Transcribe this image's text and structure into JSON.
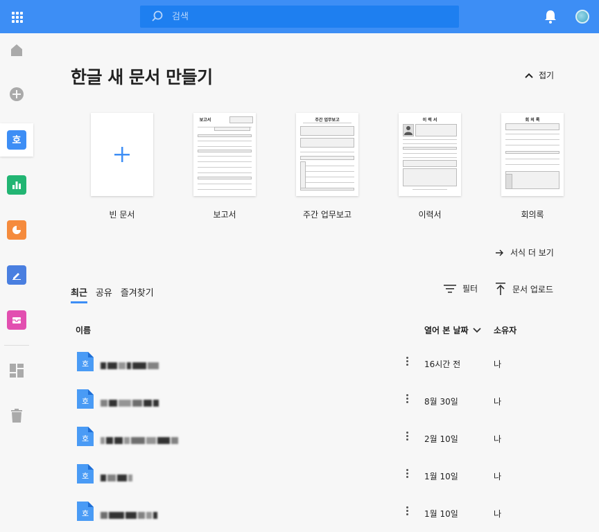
{
  "topbar": {
    "search_placeholder": "검색"
  },
  "sidebar": {
    "items": [
      {
        "name": "home-icon"
      },
      {
        "name": "add-icon"
      },
      {
        "name": "hwp-app-icon",
        "glyph": "호",
        "color": "#3d8ef5",
        "active": true
      },
      {
        "name": "sheet-app-icon",
        "color": "#22b573"
      },
      {
        "name": "slide-app-icon",
        "color": "#f58b3d"
      },
      {
        "name": "pdf-app-icon",
        "color": "#4a7fe0"
      },
      {
        "name": "mail-app-icon",
        "color": "#e24fb0"
      },
      {
        "name": "dashboard-icon"
      },
      {
        "name": "trash-icon"
      }
    ]
  },
  "main": {
    "title": "한글 새 문서 만들기",
    "collapse_label": "접기",
    "templates": [
      {
        "label": "빈 문서"
      },
      {
        "label": "보고서",
        "thumb_title": "보고서"
      },
      {
        "label": "주간 업무보고",
        "thumb_title": "주간 업무보고"
      },
      {
        "label": "이력서",
        "thumb_title": "이 력 서"
      },
      {
        "label": "회의록",
        "thumb_title": "회 의 록"
      }
    ],
    "more_templates_label": "서식 더 보기",
    "tabs": [
      "최근",
      "공유",
      "즐겨찾기"
    ],
    "filter_label": "필터",
    "upload_label": "문서 업로드",
    "columns": {
      "name": "이름",
      "opened": "열어 본 날짜",
      "owner": "소유자"
    },
    "rows": [
      {
        "date": "16시간 전",
        "owner": "나"
      },
      {
        "date": "8월 30일",
        "owner": "나"
      },
      {
        "date": "2월 10일",
        "owner": "나"
      },
      {
        "date": "1월 10일",
        "owner": "나"
      },
      {
        "date": "1월 10일",
        "owner": "나"
      }
    ]
  },
  "colors": {
    "accent": "#3d8ef5",
    "topbar": "#3d8ef5",
    "search_bg": "#1e7ff0"
  }
}
